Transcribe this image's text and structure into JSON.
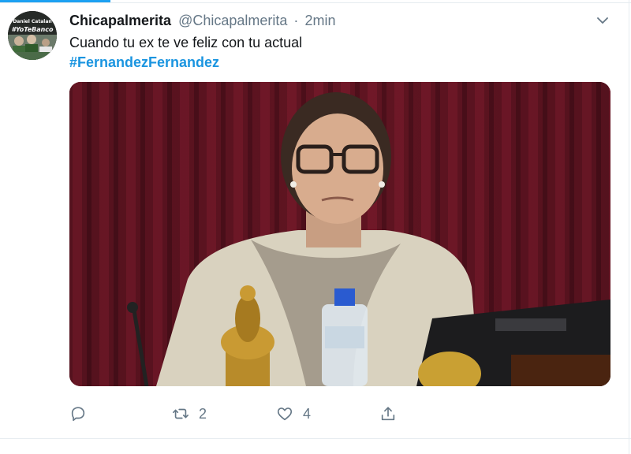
{
  "tweet": {
    "display_name": "Chicapalmerita",
    "handle": "@Chicapalmerita",
    "separator": "·",
    "time": "2min",
    "text": "Cuando tu ex te ve feliz con tu actual",
    "hashtag": "#FernandezFernandez"
  },
  "avatar": {
    "line1": "Daniel Catalan",
    "line2": "#YoTeBanco"
  },
  "actions": {
    "reply_icon": "reply-icon",
    "retweet_icon": "retweet-icon",
    "retweet_count": "2",
    "like_icon": "heart-icon",
    "like_count": "4",
    "share_icon": "share-icon"
  },
  "colors": {
    "accent": "#1da1f2",
    "hashtag": "#1b95e0",
    "muted": "#657786"
  }
}
